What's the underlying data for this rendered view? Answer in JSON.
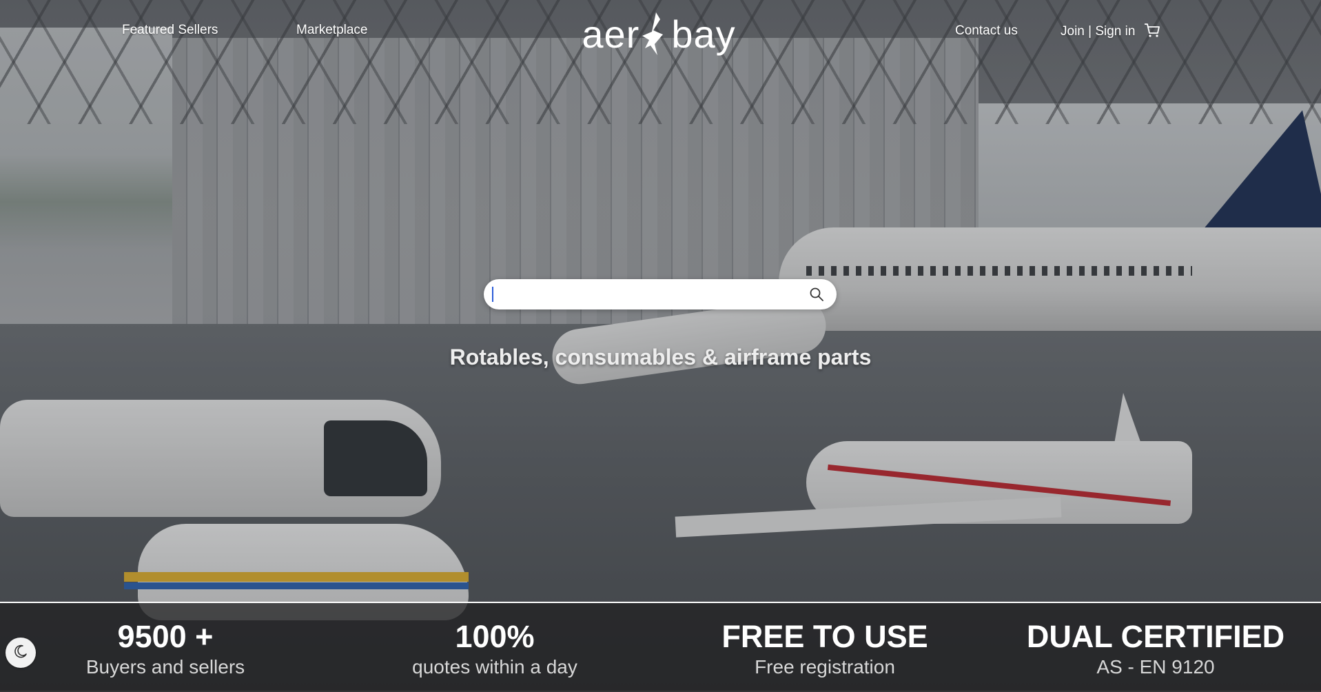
{
  "nav": {
    "featured_sellers": "Featured Sellers",
    "marketplace": "Marketplace",
    "contact_us": "Contact us",
    "join_sign_in": "Join | Sign in",
    "cart_icon": "cart-icon"
  },
  "logo": {
    "left": "aer",
    "right": "bay"
  },
  "search": {
    "value": "",
    "placeholder": "",
    "icon": "search-icon"
  },
  "hero": {
    "tagline": "Rotables, consumables & airframe parts"
  },
  "stats": [
    {
      "value": "9500 +",
      "label": "Buyers and sellers"
    },
    {
      "value": "100%",
      "label": "quotes within a day"
    },
    {
      "value": "FREE TO USE",
      "label": "Free registration"
    },
    {
      "value": "DUAL CERTIFIED",
      "label": "AS - EN 9120"
    }
  ],
  "theme_toggle": {
    "icon": "moon-icon"
  },
  "colors": {
    "text_primary": "#ffffff",
    "stats_bar_bg": "#1e1e20",
    "search_bg": "#ffffff",
    "caret": "#2a5bd7"
  }
}
